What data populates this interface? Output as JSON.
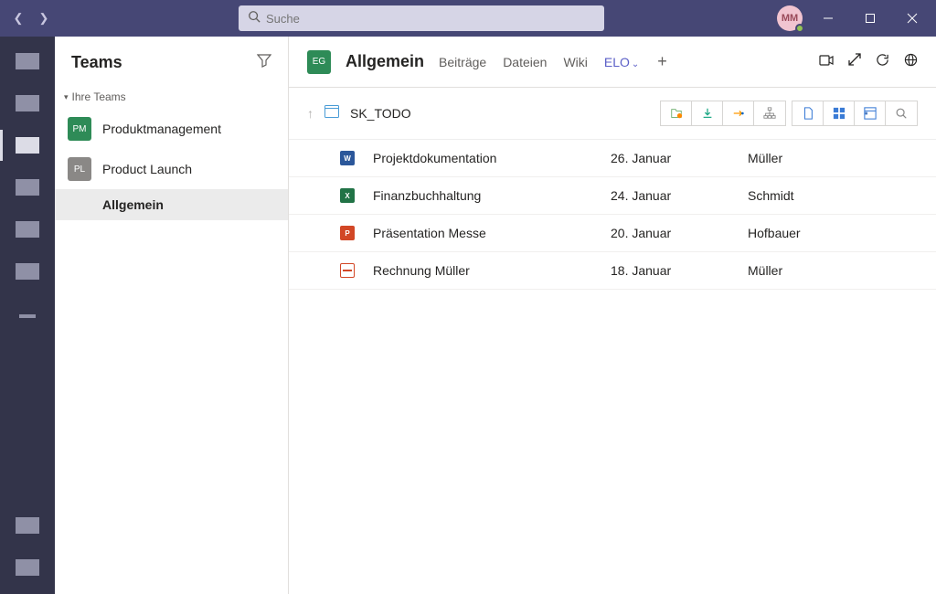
{
  "titlebar": {
    "search_placeholder": "Suche",
    "avatar_initials": "MM"
  },
  "sidebar": {
    "title": "Teams",
    "section_label": "Ihre Teams",
    "teams": [
      {
        "initials": "PM",
        "name": "Produktmanagement",
        "color": "#2e8b57"
      },
      {
        "initials": "PL",
        "name": "Product Launch",
        "color": "#8a8886"
      }
    ],
    "channels": [
      {
        "name": "Allgemein",
        "active": true
      }
    ]
  },
  "content_header": {
    "team_initials": "EG",
    "channel_title": "Allgemein",
    "tabs": [
      {
        "label": "Beiträge"
      },
      {
        "label": "Dateien"
      },
      {
        "label": "Wiki"
      },
      {
        "label": "ELO",
        "active": true
      }
    ]
  },
  "elo": {
    "folder_name": "SK_TODO",
    "files": [
      {
        "icon": "word",
        "name": "Projektdokumentation",
        "date": "26. Januar",
        "user": "Müller"
      },
      {
        "icon": "excel",
        "name": "Finanzbuchhaltung",
        "date": "24. Januar",
        "user": "Schmidt"
      },
      {
        "icon": "ppt",
        "name": "Präsentation Messe",
        "date": "20. Januar",
        "user": "Hofbauer"
      },
      {
        "icon": "pdf",
        "name": "Rechnung Müller",
        "date": "18. Januar",
        "user": "Müller"
      }
    ]
  }
}
